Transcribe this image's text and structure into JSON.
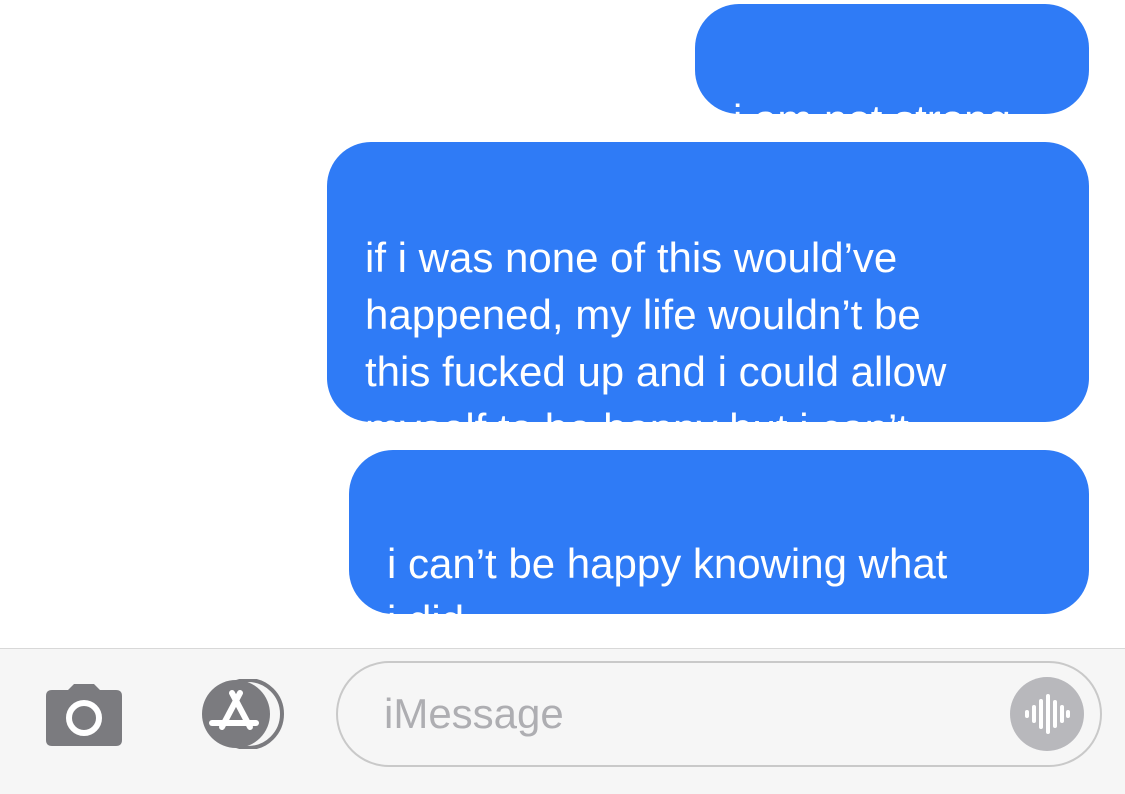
{
  "conversation": {
    "messages": [
      {
        "sender": "me",
        "text": "i am not strong"
      },
      {
        "sender": "me",
        "text": "if i was none of this would’ve\nhappened, my life wouldn’t be\nthis fucked up and i could allow\nmyself to be happy but i can’t"
      },
      {
        "sender": "me",
        "text": "i can’t be happy knowing what\ni did"
      }
    ],
    "bubble_color": "#2f7bf6"
  },
  "input_bar": {
    "placeholder": "iMessage",
    "camera_icon": "camera-icon",
    "apps_icon": "app-store-icon",
    "audio_icon": "audio-waveform-icon"
  }
}
